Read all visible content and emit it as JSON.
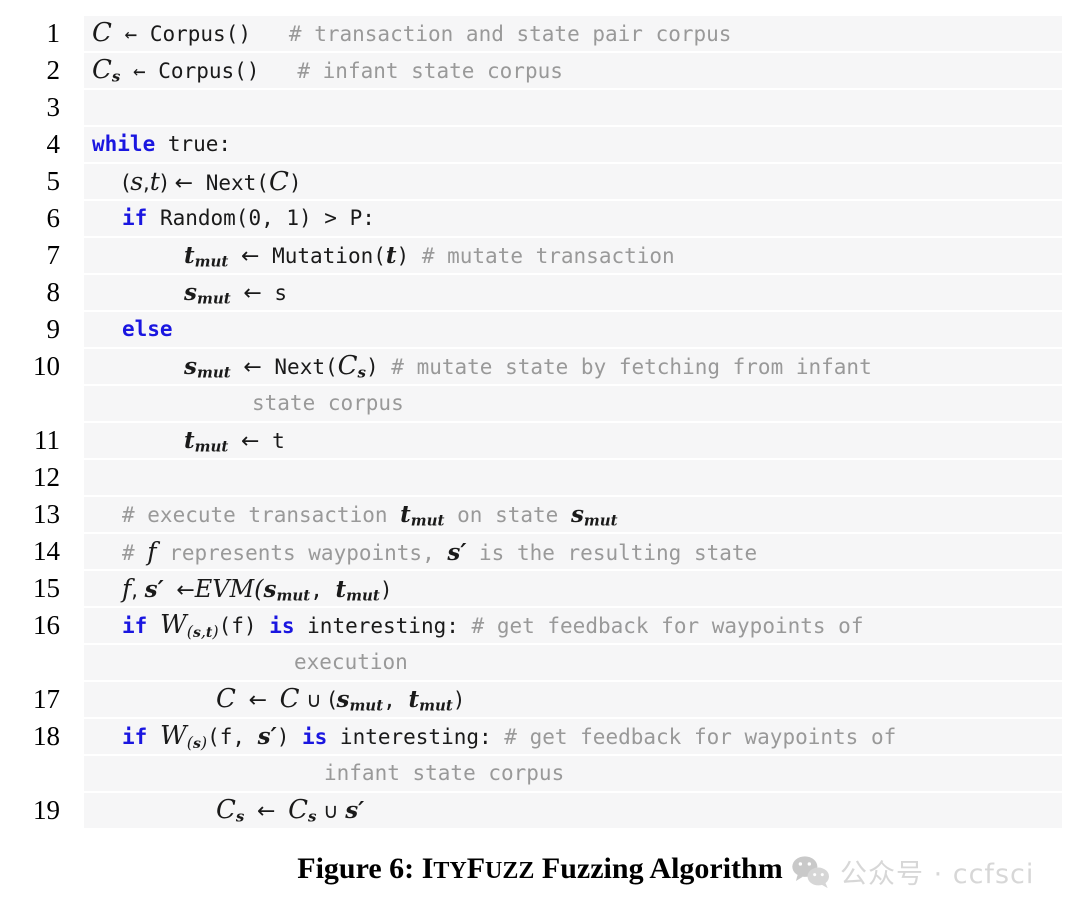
{
  "figure": {
    "caption_prefix": "Figure 6: ",
    "caption_tool_first": "I",
    "caption_tool_rest1": "TY",
    "caption_tool_second": "F",
    "caption_tool_rest2": "UZZ",
    "caption_suffix": " Fuzzing Algorithm",
    "caption_full": "Figure 6: ItyFuzz Fuzzing Algorithm"
  },
  "watermark": {
    "icon": "wechat-official-account-icon",
    "text": "公众号 · ccfsci"
  },
  "colors": {
    "keyword": "#1a16e0",
    "comment": "#999999",
    "code_text": "#1a1a1a",
    "row_background": "#f6f6f7",
    "page_background": "#ffffff",
    "watermark_text": "#c9c9c9"
  },
  "code": {
    "language": "pseudocode",
    "line_numbers": [
      "1",
      "2",
      "3",
      "4",
      "5",
      "6",
      "7",
      "8",
      "9",
      "10",
      "",
      "11",
      "12",
      "13",
      "14",
      "15",
      "16",
      "",
      "17",
      "18",
      "",
      "19"
    ],
    "lines": [
      {
        "num": "1",
        "text": "C ← Corpus()   # transaction and state pair corpus"
      },
      {
        "num": "2",
        "text": "Cs ← Corpus()   # infant state corpus"
      },
      {
        "num": "3",
        "text": ""
      },
      {
        "num": "4",
        "text": "while true:"
      },
      {
        "num": "5",
        "text": "    (s,t) ← Next(C)"
      },
      {
        "num": "6",
        "text": "    if Random(0, 1) > P:"
      },
      {
        "num": "7",
        "text": "        tmut ← Mutation(t) # mutate transaction"
      },
      {
        "num": "8",
        "text": "        smut ← s"
      },
      {
        "num": "9",
        "text": "    else"
      },
      {
        "num": "10",
        "text": "        smut ← Next(Cs) # mutate state by fetching from infant"
      },
      {
        "num": "",
        "text": "            state corpus"
      },
      {
        "num": "11",
        "text": "        tmut ← t"
      },
      {
        "num": "12",
        "text": ""
      },
      {
        "num": "13",
        "text": "    # execute transaction tmut on state smut"
      },
      {
        "num": "14",
        "text": "    # f represents waypoints, s' is the resulting state"
      },
      {
        "num": "15",
        "text": "    f, s' ←EVM(smut, tmut)"
      },
      {
        "num": "16",
        "text": "    if W(s,t)(f) is interesting: # get feedback for waypoints of"
      },
      {
        "num": "",
        "text": "            execution"
      },
      {
        "num": "17",
        "text": "        C ← C ∪ (smut, tmut)"
      },
      {
        "num": "18",
        "text": "    if W(s)(f, s') is interesting: # get feedback for waypoints of"
      },
      {
        "num": "",
        "text": "            infant state corpus"
      },
      {
        "num": "19",
        "text": "        Cs ← Cs ∪ s'"
      }
    ],
    "tokens": {
      "kw_while": "while",
      "kw_if": "if",
      "kw_else": "else",
      "kw_is": "is",
      "t_true": " true:",
      "t_corpus_call": " ← Corpus()",
      "c_line1": "# transaction and state pair corpus",
      "c_line2": "# infant state corpus",
      "c_line7": "# mutate transaction",
      "c_line10": "# mutate state by fetching from infant",
      "c_line10_wrap": "state corpus",
      "c_line13_a": "# execute transaction ",
      "c_line13_b": " on state ",
      "c_line14_a": "# ",
      "c_line14_b": " represents waypoints, ",
      "c_line14_c": " is the resulting state",
      "c_line16": "# get feedback for waypoints of",
      "c_line16_wrap": "execution",
      "c_line18": "# get feedback for waypoints of",
      "c_line18_wrap": "infant state corpus",
      "l5": "(s,t) ← Next(C)",
      "l5_open": "(",
      "l5_comma": ",",
      "l5_close": ") ",
      "l5_next": " Next(",
      "l5_end": ")",
      "l6_rand": " Random(0, 1) > P:",
      "l7_mutation": " Mutation(",
      "l7_close": ")",
      "l8_s": " s",
      "l10_next": " Next(",
      "l10_close": ") ",
      "l11_t": " t",
      "l15_fs": "f, s",
      "l15_evm": "EVM(",
      "l15_comma": ", ",
      "l15_close": ")",
      "l16_f": "(f) ",
      "l16_interesting": " interesting: ",
      "l17_union": " ∪ (",
      "l17_comma": ", ",
      "l17_close": ")",
      "l18_fs": "(f, ",
      "l18_close": ") ",
      "l19_union": " ∪ ",
      "arrow": "←",
      "union": "∪",
      "sub_mut": "mut",
      "sub_s": "s",
      "prime": "′",
      "var_C": "C",
      "var_s": "s",
      "var_t": "t",
      "var_f": "f",
      "var_W": "W"
    }
  }
}
